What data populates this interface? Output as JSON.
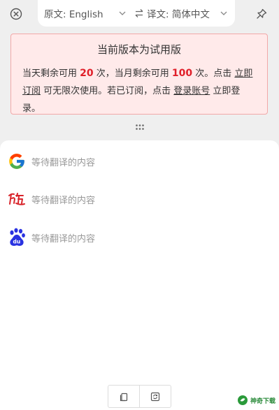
{
  "header": {
    "source_label": "原文: English",
    "target_label": "译文: 简体中文"
  },
  "trial": {
    "title": "当前版本为试用版",
    "line_prefix": "当天剩余可用 ",
    "day_count": "20",
    "line_mid": " 次，当月剩余可用 ",
    "month_count": "100",
    "line_mid2": " 次。点击 ",
    "subscribe_link": "立即订阅",
    "line_mid3": " 可无限次使用。若已订阅，点击 ",
    "login_link": "登录账号",
    "line_suffix": " 立即登录。"
  },
  "engines": [
    {
      "name": "google",
      "status": "等待翻译的内容"
    },
    {
      "name": "youdao",
      "status": "等待翻译的内容"
    },
    {
      "name": "baidu",
      "status": "等待翻译的内容"
    }
  ],
  "watermark": {
    "text": "神奇下载"
  },
  "colors": {
    "accent_red": "#e0202a",
    "trial_bg": "#ffeaea",
    "trial_border": "#f2a8a8"
  }
}
